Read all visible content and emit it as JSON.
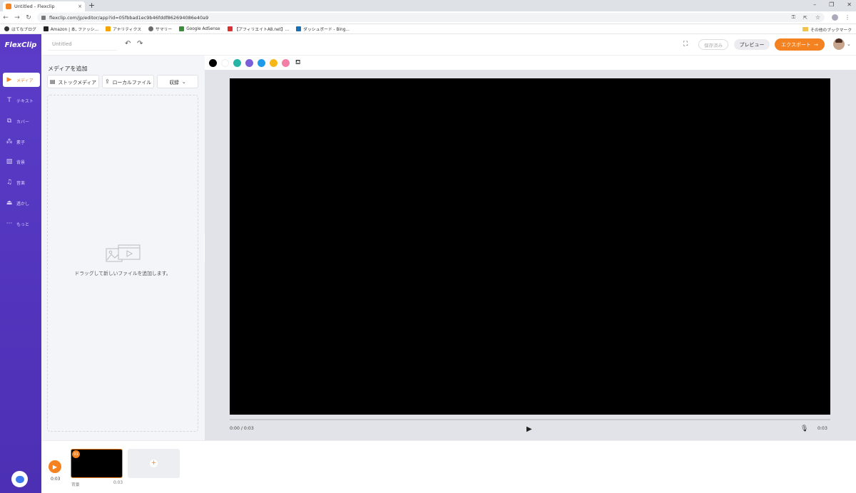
{
  "browser": {
    "tab_title": "Untitled - Flexclip",
    "tab_close": "×",
    "new_tab": "+",
    "url": "flexclip.com/jp/editor/app?id=05fbbad1ec9b46fddf862694086e40a9",
    "bookmarks": [
      {
        "label": "はてなブログ",
        "color": "#333333"
      },
      {
        "label": "Amazon | 本, ファッシ...",
        "color": "#222222"
      },
      {
        "label": "アナリティクス",
        "color": "#f4a300"
      },
      {
        "label": "サマリー",
        "color": "#6a6a6a"
      },
      {
        "label": "Google AdSense",
        "color": "#3b8d3b"
      },
      {
        "label": "【アフィリエイトA8.net】...",
        "color": "#d93030"
      },
      {
        "label": "ダッシュボード - Bing...",
        "color": "#1a6fb3"
      }
    ],
    "other_bookmarks": "その他のブックマーク"
  },
  "header": {
    "logo": "FlexClip",
    "project_name": "Untitled",
    "save_label": "保存済み",
    "preview_label": "プレビュー",
    "export_label": "エクスポート"
  },
  "sidebar": {
    "items": [
      {
        "label": "メディア",
        "icon": "media-icon"
      },
      {
        "label": "テキスト",
        "icon": "text-icon"
      },
      {
        "label": "カバー",
        "icon": "cover-icon"
      },
      {
        "label": "素子",
        "icon": "elements-icon"
      },
      {
        "label": "背景",
        "icon": "background-icon"
      },
      {
        "label": "音楽",
        "icon": "music-icon"
      },
      {
        "label": "透かし",
        "icon": "watermark-icon"
      },
      {
        "label": "もっと",
        "icon": "more-icon"
      }
    ]
  },
  "panel": {
    "title": "メディアを追加",
    "stock_label": "ストックメディア",
    "local_label": "ローカルファイル",
    "record_label": "収録",
    "drop_text": "ドラッグして新しいファイルを追加します。"
  },
  "colors": [
    "#000000",
    "#ffffff",
    "#26b5a5",
    "#7a5fd8",
    "#1e9be8",
    "#f6b718",
    "#f47fa4"
  ],
  "player": {
    "current_time": "0:00 / 0:03",
    "duration": "0:03"
  },
  "timeline": {
    "total_duration": "0:03",
    "clip_number": "01",
    "clip_label": "背景",
    "clip_duration": "0:03"
  }
}
